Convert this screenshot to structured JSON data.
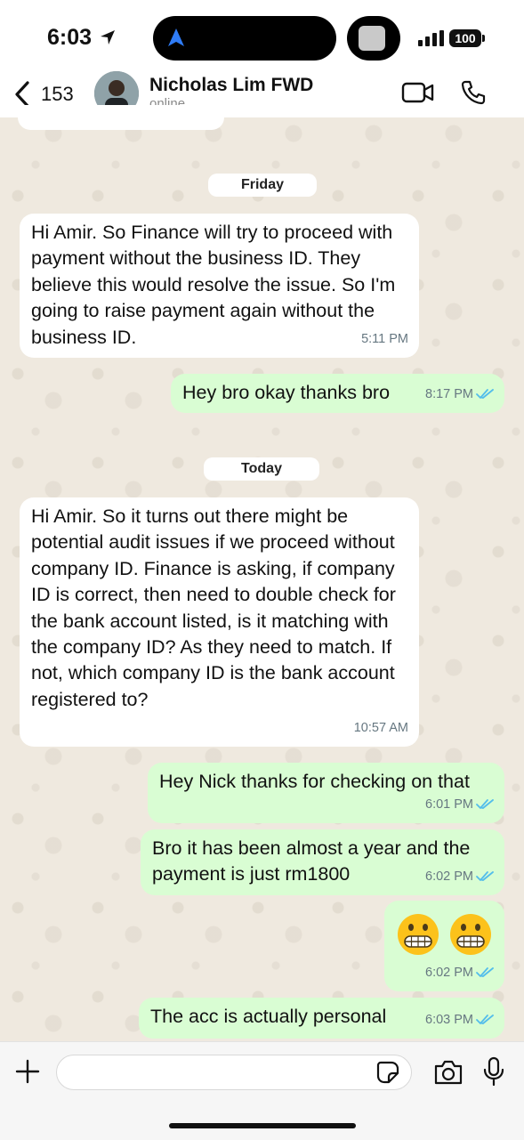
{
  "status_bar": {
    "time": "6:03",
    "battery": "100"
  },
  "header": {
    "back_count": "153",
    "contact_name": "Nicholas Lim FWD",
    "contact_status": "online"
  },
  "chat": {
    "date_friday": "Friday",
    "date_today": "Today",
    "messages": [
      {
        "dir": "in",
        "text": "Hi Amir. So Finance will try to proceed with payment without the business ID. They believe this would resolve the issue. So I'm going to raise payment again without the business ID.",
        "time": "5:11 PM"
      },
      {
        "dir": "out",
        "text": "Hey bro okay thanks bro",
        "time": "8:17 PM",
        "status": "read"
      },
      {
        "dir": "in",
        "text": "Hi Amir. So it turns out there might be potential audit issues if we proceed without company ID. Finance is asking, if company ID is correct, then need to double check for the bank account listed, is it matching with the company ID? As they need to match. If not, which company ID is the bank account registered to?",
        "time": "10:57 AM"
      },
      {
        "dir": "out",
        "text": "Hey Nick thanks for checking on that",
        "time": "6:01 PM",
        "status": "read"
      },
      {
        "dir": "out",
        "text": "Bro it has been almost a year and the payment is just rm1800",
        "time": "6:02 PM",
        "status": "read"
      },
      {
        "dir": "out",
        "text": "😬 😬",
        "emoji": [
          "grimacing-face",
          "grimacing-face"
        ],
        "time": "6:02 PM",
        "status": "read"
      },
      {
        "dir": "out",
        "text": "The acc is actually personal",
        "time": "6:03 PM",
        "status": "read"
      }
    ]
  },
  "colors": {
    "incoming_bubble": "#ffffff",
    "outgoing_bubble": "#d9fdd3",
    "read_tick": "#53bdeb",
    "timestamp": "#667781"
  },
  "icons": [
    "location-arrow-icon",
    "navigation-arrow-icon",
    "signal-icon",
    "battery-icon",
    "back-chevron-icon",
    "video-call-icon",
    "phone-call-icon",
    "plus-icon",
    "sticker-icon",
    "camera-icon",
    "microphone-icon",
    "double-check-icon"
  ]
}
